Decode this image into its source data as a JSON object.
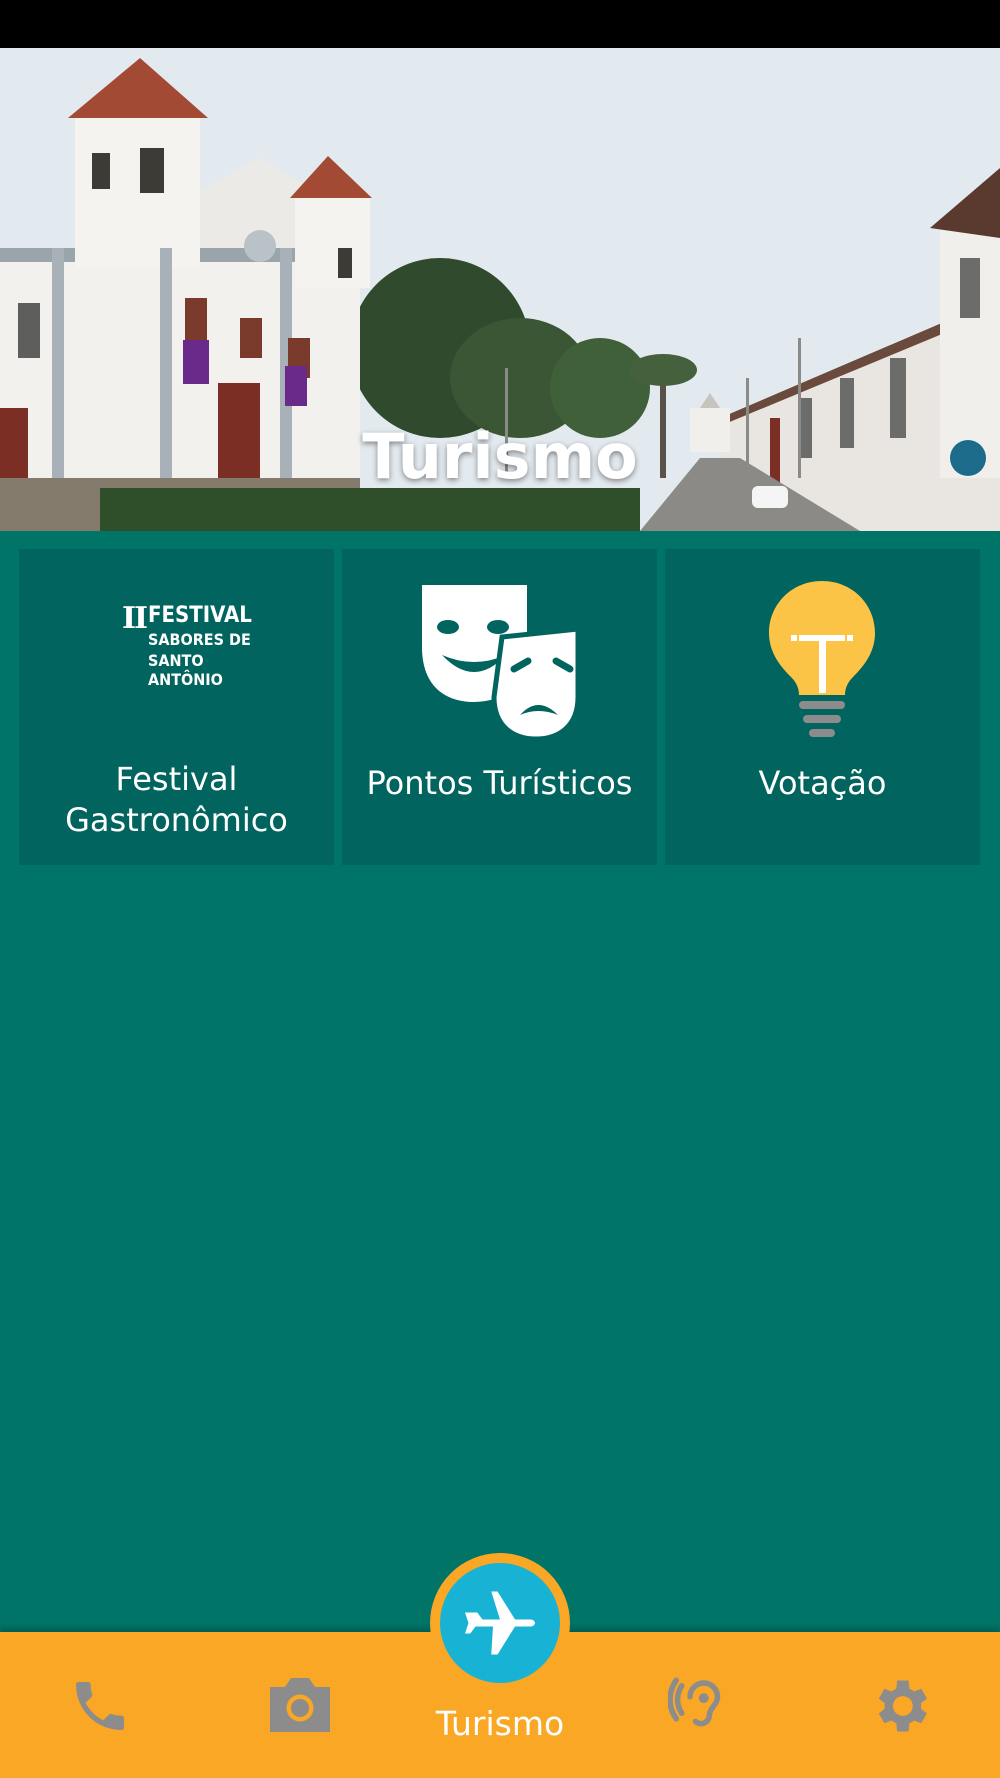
{
  "hero": {
    "title": "Turismo"
  },
  "tiles": [
    {
      "label_line1": "Festival",
      "label_line2": "Gastronômico",
      "icon": "festival-logo",
      "logo_text": {
        "numeral": "II",
        "line1": "FESTIVAL",
        "line2": "SABORES DE",
        "line3": "SANTO ANTÔNIO"
      }
    },
    {
      "label": "Pontos Turísticos",
      "icon": "theater-masks-icon"
    },
    {
      "label": "Votação",
      "icon": "lightbulb-icon"
    }
  ],
  "bottom_nav": {
    "items": [
      {
        "icon": "phone-icon",
        "active": false
      },
      {
        "icon": "camera-icon",
        "active": false
      },
      {
        "icon": "airplane-icon",
        "label": "Turismo",
        "active": true
      },
      {
        "icon": "hearing-icon",
        "active": false
      },
      {
        "icon": "gear-icon",
        "active": false
      }
    ]
  },
  "colors": {
    "background": "#007567",
    "tile": "#02645e",
    "nav_bar": "#f9a724",
    "fab": "#18b3d4",
    "inactive_icon": "#8c8c8c",
    "bulb": "#fcc447"
  }
}
